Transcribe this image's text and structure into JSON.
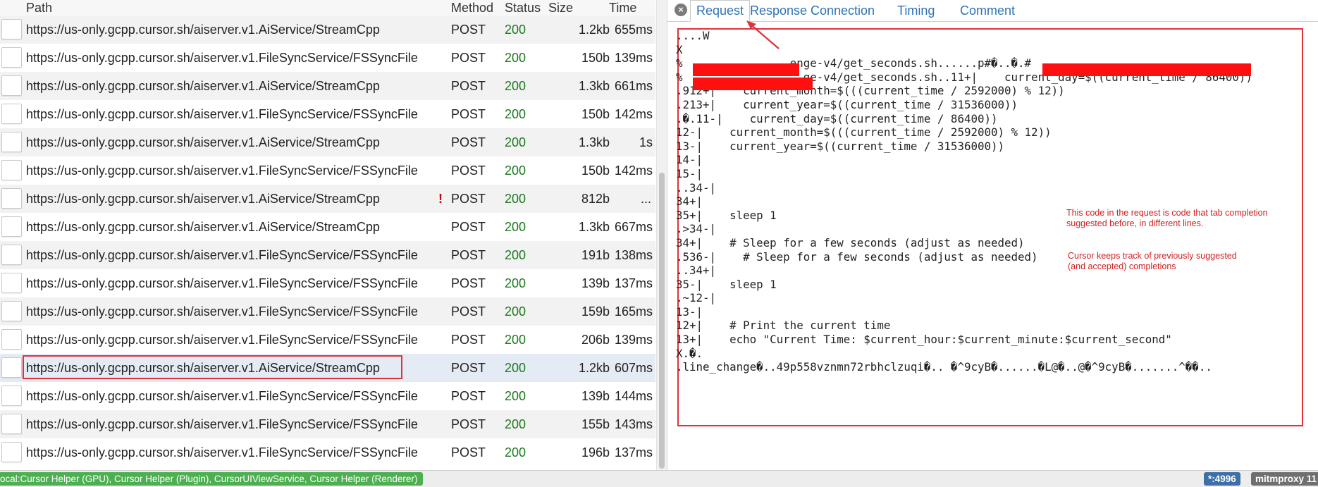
{
  "columns": {
    "path": "Path",
    "method": "Method",
    "status": "Status",
    "size": "Size",
    "time": "Time"
  },
  "flows": [
    {
      "path": "https://us-only.gcpp.cursor.sh/aiserver.v1.AiService/StreamCpp",
      "method": "POST",
      "status": "200",
      "size": "1.2kb",
      "time": "655ms"
    },
    {
      "path": "https://us-only.gcpp.cursor.sh/aiserver.v1.FileSyncService/FSSyncFile",
      "method": "POST",
      "status": "200",
      "size": "150b",
      "time": "139ms"
    },
    {
      "path": "https://us-only.gcpp.cursor.sh/aiserver.v1.AiService/StreamCpp",
      "method": "POST",
      "status": "200",
      "size": "1.3kb",
      "time": "661ms"
    },
    {
      "path": "https://us-only.gcpp.cursor.sh/aiserver.v1.FileSyncService/FSSyncFile",
      "method": "POST",
      "status": "200",
      "size": "150b",
      "time": "142ms"
    },
    {
      "path": "https://us-only.gcpp.cursor.sh/aiserver.v1.AiService/StreamCpp",
      "method": "POST",
      "status": "200",
      "size": "1.3kb",
      "time": "1s"
    },
    {
      "path": "https://us-only.gcpp.cursor.sh/aiserver.v1.FileSyncService/FSSyncFile",
      "method": "POST",
      "status": "200",
      "size": "150b",
      "time": "142ms"
    },
    {
      "path": "https://us-only.gcpp.cursor.sh/aiserver.v1.AiService/StreamCpp",
      "method": "POST",
      "status": "200",
      "size": "812b",
      "time": "...",
      "warning": "!"
    },
    {
      "path": "https://us-only.gcpp.cursor.sh/aiserver.v1.AiService/StreamCpp",
      "method": "POST",
      "status": "200",
      "size": "1.3kb",
      "time": "667ms"
    },
    {
      "path": "https://us-only.gcpp.cursor.sh/aiserver.v1.FileSyncService/FSSyncFile",
      "method": "POST",
      "status": "200",
      "size": "191b",
      "time": "138ms"
    },
    {
      "path": "https://us-only.gcpp.cursor.sh/aiserver.v1.FileSyncService/FSSyncFile",
      "method": "POST",
      "status": "200",
      "size": "139b",
      "time": "137ms"
    },
    {
      "path": "https://us-only.gcpp.cursor.sh/aiserver.v1.FileSyncService/FSSyncFile",
      "method": "POST",
      "status": "200",
      "size": "159b",
      "time": "165ms"
    },
    {
      "path": "https://us-only.gcpp.cursor.sh/aiserver.v1.FileSyncService/FSSyncFile",
      "method": "POST",
      "status": "200",
      "size": "206b",
      "time": "139ms"
    },
    {
      "path": "https://us-only.gcpp.cursor.sh/aiserver.v1.AiService/StreamCpp",
      "method": "POST",
      "status": "200",
      "size": "1.2kb",
      "time": "607ms",
      "selected": true
    },
    {
      "path": "https://us-only.gcpp.cursor.sh/aiserver.v1.FileSyncService/FSSyncFile",
      "method": "POST",
      "status": "200",
      "size": "139b",
      "time": "144ms"
    },
    {
      "path": "https://us-only.gcpp.cursor.sh/aiserver.v1.FileSyncService/FSSyncFile",
      "method": "POST",
      "status": "200",
      "size": "155b",
      "time": "143ms"
    },
    {
      "path": "https://us-only.gcpp.cursor.sh/aiserver.v1.FileSyncService/FSSyncFile",
      "method": "POST",
      "status": "200",
      "size": "196b",
      "time": "137ms"
    }
  ],
  "detail": {
    "close_icon": "×",
    "tabs": [
      "Request",
      "Response",
      "Connection",
      "Timing",
      "Comment"
    ],
    "active_tab": "Request",
    "content_lines": [
      "....W",
      "X",
      "%                enge-v4/get_seconds.sh......p#�..�.#                                             0.:�.",
      "%                  ge-v4/get_seconds.sh..11+|    current_day=$((current_time / 86400))",
      ".912+|    current_month=$(((current_time / 2592000) % 12))",
      ".213+|    current_year=$((current_time / 31536000))",
      ".�.11-|    current_day=$((current_time / 86400))",
      "12-|    current_month=$(((current_time / 2592000) % 12))",
      "13-|    current_year=$((current_time / 31536000))",
      "14-|",
      "15-|",
      "..34-|",
      "34+|",
      "35+|    sleep 1",
      ".>34-|",
      "34+|    # Sleep for a few seconds (adjust as needed)",
      ".536-|    # Sleep for a few seconds (adjust as needed)",
      "..34+|",
      "35-|    sleep 1",
      ".~12-|",
      "13-|",
      "12+|    # Print the current time",
      "13+|    echo \"Current Time: $current_hour:$current_minute:$current_second\"",
      "X.�.",
      ".line_change�..49p558vznmn72rbhclzuqi�.. �^9cyB�......�L@�..@�^9cyB�.......^��.."
    ],
    "annotation_1": "This code in the request is code that tab completion\nsuggested before, in different lines.",
    "annotation_2": "Cursor keeps track of previously suggested\n(and accepted) completions"
  },
  "statusbar": {
    "filter": "ocal:Cursor Helper (GPU), Cursor Helper (Plugin), CursorUIViewService, Cursor Helper (Renderer)",
    "port": "*:4996",
    "app": "mitmproxy 11"
  },
  "colors": {
    "accent_red": "#e0313a",
    "status_green": "#1f7a1f",
    "tab_blue": "#2f72b5",
    "filter_green": "#4caf50",
    "port_blue": "#3d6fa8"
  }
}
